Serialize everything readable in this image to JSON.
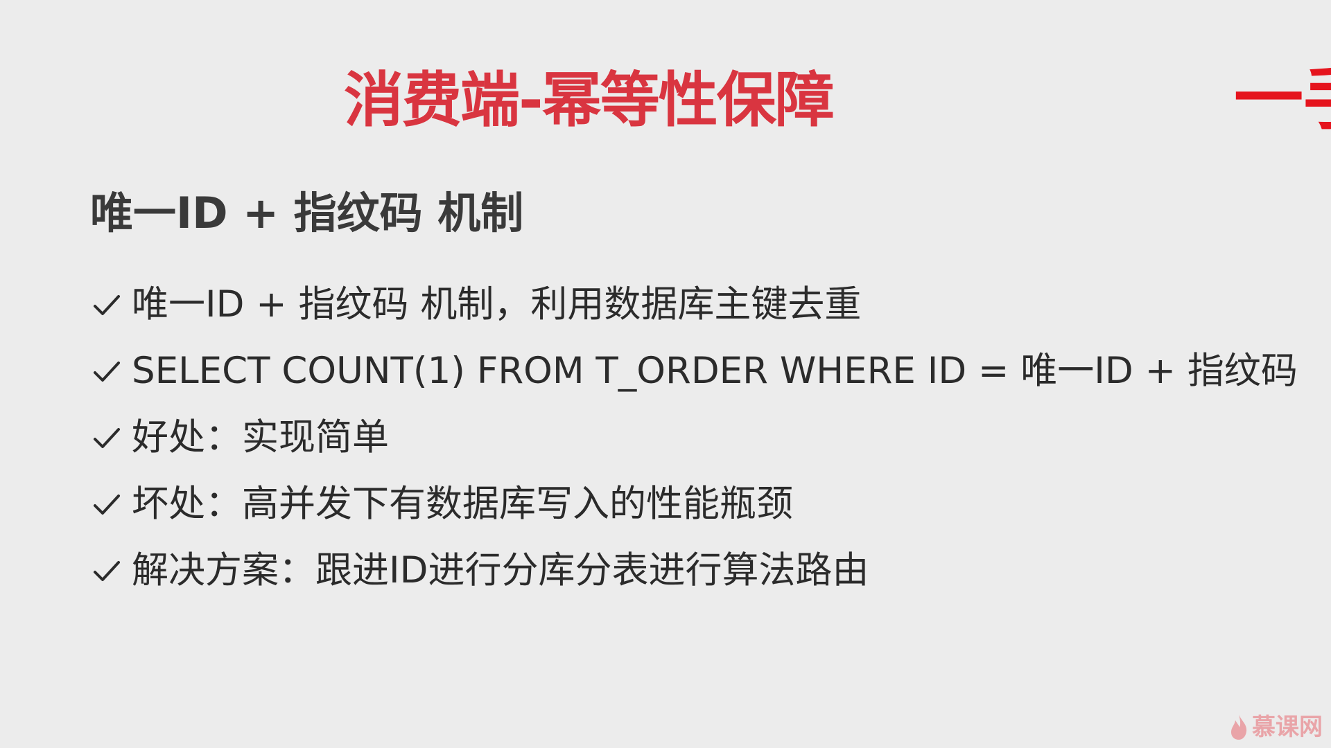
{
  "slide": {
    "title": "消费端-幂等性保障",
    "corner_title": "一手",
    "subtitle": "唯一ID + 指纹码 机制",
    "bullets": [
      "唯一ID + 指纹码 机制，利用数据库主键去重",
      "SELECT COUNT(1) FROM T_ORDER WHERE ID = 唯一ID + 指纹码",
      "好处：实现简单",
      "坏处：高并发下有数据库写入的性能瓶颈",
      "解决方案：跟进ID进行分库分表进行算法路由"
    ],
    "bullet_icon": "checkmark-icon",
    "watermark": "慕课网",
    "watermark_icon": "flame-icon"
  },
  "colors": {
    "background": "#ececec",
    "title": "#d93540",
    "corner_title": "#e5141d",
    "subtitle": "#3a3a3a",
    "body_text": "#2b2b2b",
    "watermark": "#e76b72"
  }
}
